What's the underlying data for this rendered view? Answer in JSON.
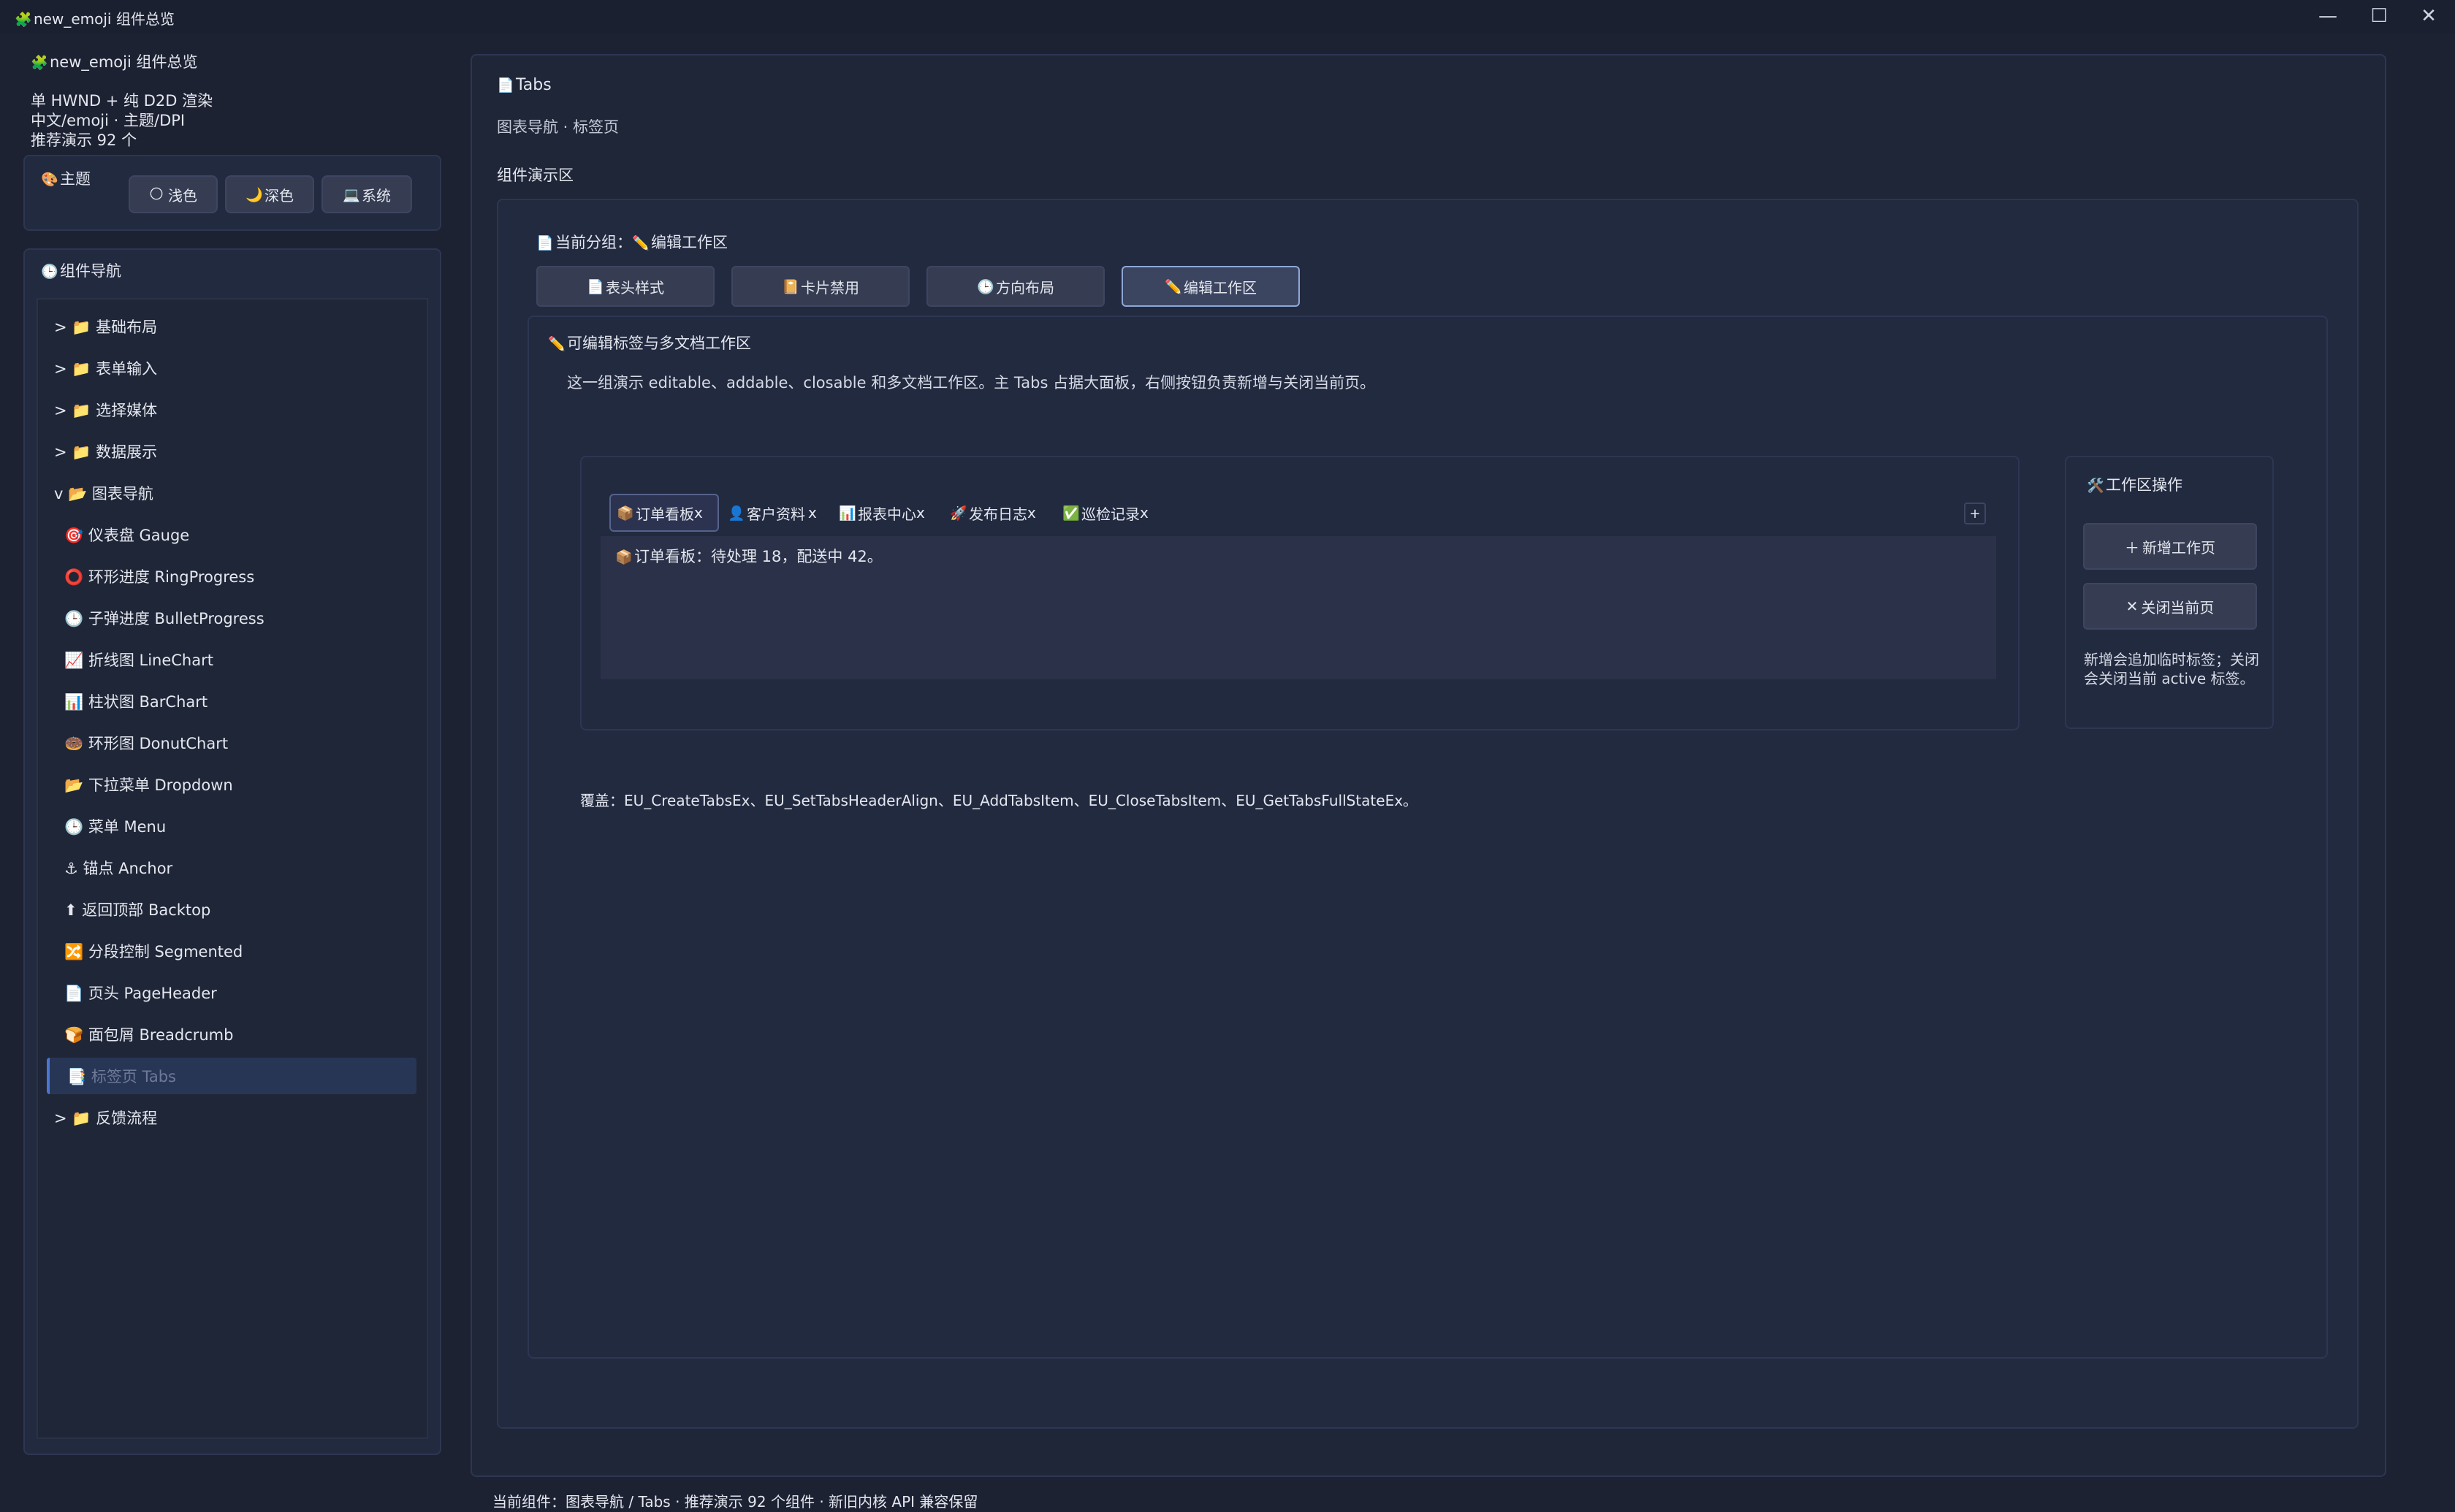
{
  "window": {
    "title": "new_emoji 组件总览",
    "controls": {
      "minimize": "—",
      "maximize": "☐",
      "close": "✕"
    }
  },
  "sidebar": {
    "app_title": "new_emoji 组件总览",
    "info_lines": [
      "单 HWND + 纯 D2D 渲染",
      "中文/emoji · 主题/DPI",
      "推荐演示 92 个"
    ],
    "theme": {
      "label": "主题",
      "buttons": [
        {
          "label": "浅色",
          "icon": "🌕"
        },
        {
          "label": "深色",
          "icon": "🌙"
        },
        {
          "label": "系统",
          "icon": "💻"
        }
      ]
    },
    "nav": {
      "label": "组件导航",
      "items": [
        {
          "label": "> 📁 基础布局"
        },
        {
          "label": "> 📁 表单输入"
        },
        {
          "label": "> 📁 选择媒体"
        },
        {
          "label": "> 📁 数据展示"
        },
        {
          "label": "v 📂 图表导航"
        },
        {
          "label": "🎯 仪表盘 Gauge"
        },
        {
          "label": "⭕ 环形进度 RingProgress"
        },
        {
          "label": "🕒 子弹进度 BulletProgress"
        },
        {
          "label": "📈 折线图 LineChart"
        },
        {
          "label": "📊 柱状图 BarChart"
        },
        {
          "label": "🍩 环形图 DonutChart"
        },
        {
          "label": "📂 下拉菜单 Dropdown"
        },
        {
          "label": "🕒 菜单 Menu"
        },
        {
          "label": "⚓ 锚点 Anchor"
        },
        {
          "label": "⬆ 返回顶部 Backtop"
        },
        {
          "label": "🔀 分段控制 Segmented"
        },
        {
          "label": "📄 页头 PageHeader"
        },
        {
          "label": "🍞 面包屑 Breadcrumb"
        },
        {
          "label": "📑 标签页 Tabs"
        },
        {
          "label": "> 📁 反馈流程"
        }
      ]
    }
  },
  "main": {
    "title": "Tabs",
    "subtitle": "图表导航 · 标签页",
    "demo_label": "组件演示区",
    "group_label": "当前分组：",
    "group_value": "编辑工作区",
    "segments": [
      {
        "label": "表头样式",
        "icon": "📄"
      },
      {
        "label": "卡片禁用",
        "icon": "📔"
      },
      {
        "label": "方向布局",
        "icon": "🕒"
      },
      {
        "label": "编辑工作区",
        "icon": "✏️"
      }
    ],
    "section": {
      "title": "可编辑标签与多文档工作区",
      "description": "这一组演示 editable、addable、closable 和多文档工作区。主 Tabs 占据大面板，右侧按钮负责新增与关闭当前页。"
    },
    "tabs": [
      {
        "label": "订单看板",
        "icon": "📦",
        "close": "x"
      },
      {
        "label": "客户资料",
        "icon": "👤",
        "close": "x"
      },
      {
        "label": "报表中心",
        "icon": "📊",
        "close": "x"
      },
      {
        "label": "发布日志",
        "icon": "🚀",
        "close": "x"
      },
      {
        "label": "巡检记录",
        "icon": "✅",
        "close": "x"
      }
    ],
    "add_tab": "+",
    "tab_content": "订单看板：待处理 18，配送中 42。",
    "workspace": {
      "title": "工作区操作",
      "new_button": "新增工作页",
      "close_button": "关闭当前页",
      "note": "新增会追加临时标签；关闭会关闭当前 active 标签。"
    },
    "coverage": "覆盖：EU_CreateTabsEx、EU_SetTabsHeaderAlign、EU_AddTabsItem、EU_CloseTabsItem、EU_GetTabsFullStateEx。"
  },
  "status_bar": "当前组件：图表导航 / Tabs · 推荐演示 92 个组件 · 新旧内核 API 兼容保留"
}
